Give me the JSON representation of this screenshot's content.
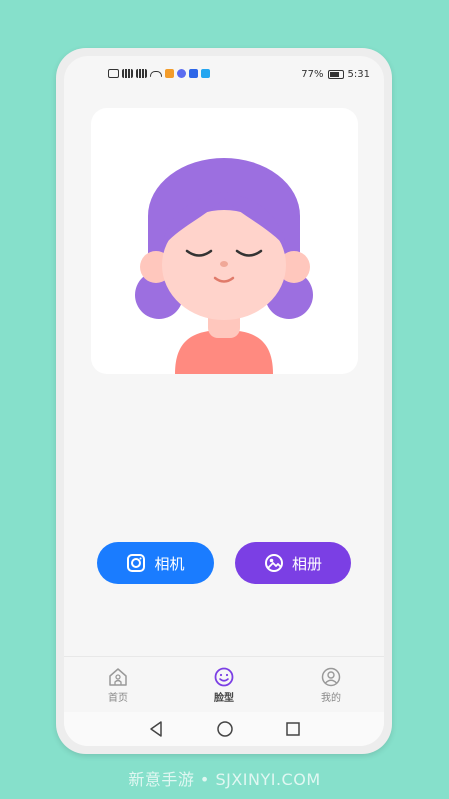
{
  "colors": {
    "background": "#86e0cb",
    "accent_blue": "#1a7cff",
    "accent_purple": "#7b3fe4",
    "hair": "#9c6fe0",
    "skin": "#ffd3cb",
    "shirt": "#ff8a80"
  },
  "status_bar": {
    "battery": "77%",
    "time": "5:31"
  },
  "actions": {
    "camera_label": "相机",
    "album_label": "相册"
  },
  "tabs": [
    {
      "label": "首页",
      "icon": "home-icon"
    },
    {
      "label": "脸型",
      "icon": "smile-face-icon"
    },
    {
      "label": "我的",
      "icon": "profile-icon"
    }
  ],
  "watermark": "新意手游 • SJXINYI.COM"
}
